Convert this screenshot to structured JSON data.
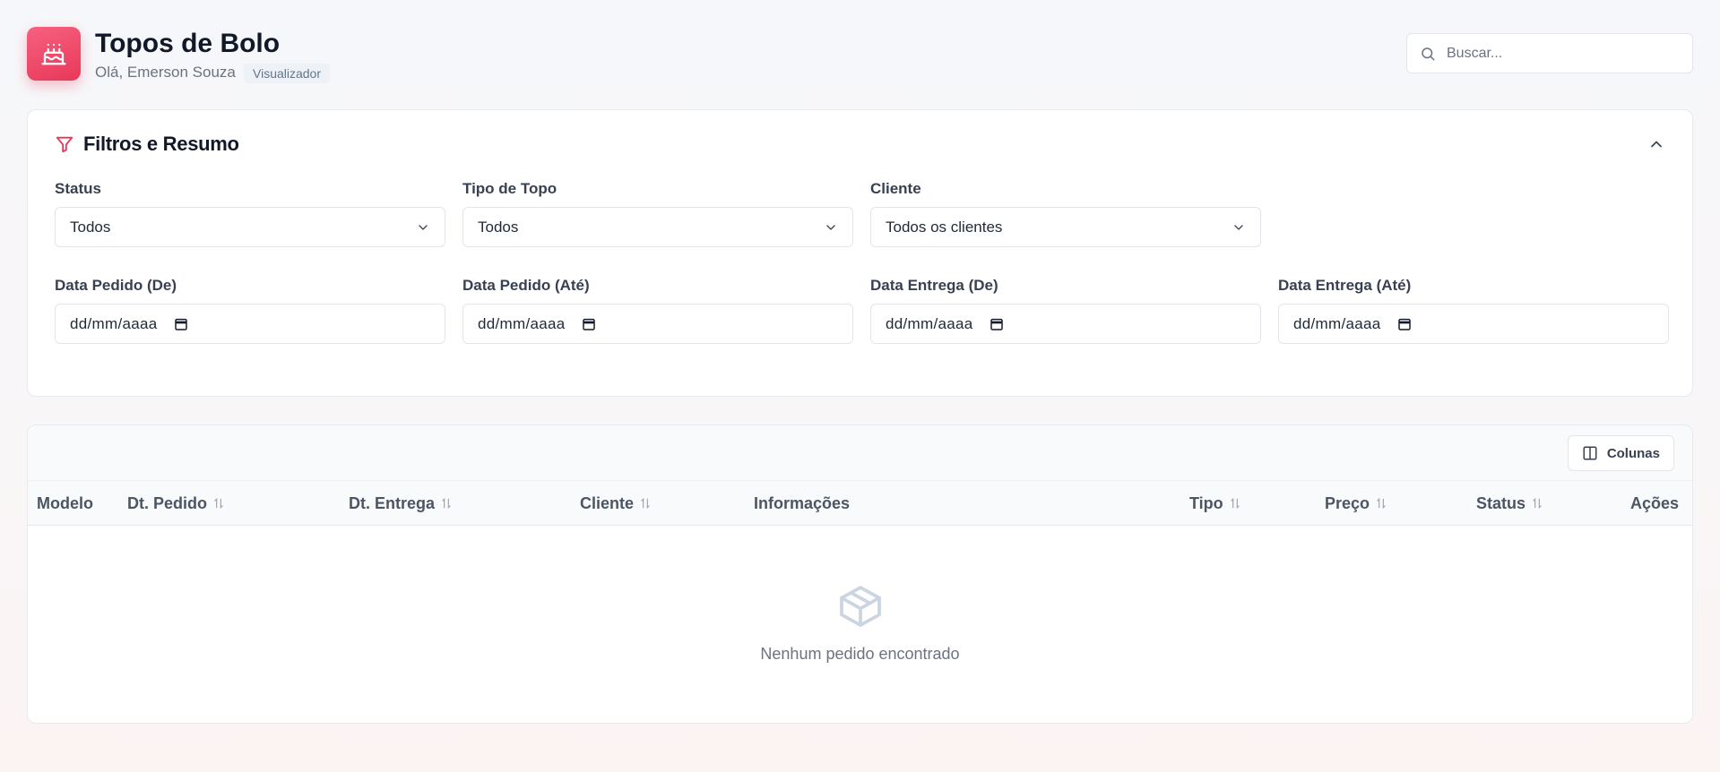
{
  "header": {
    "app_title": "Topos de Bolo",
    "greeting": "Olá, Emerson Souza",
    "role_badge": "Visualizador",
    "logo_icon": "cake-icon",
    "search_placeholder": "Buscar..."
  },
  "filters": {
    "title": "Filtros e Resumo",
    "status": {
      "label": "Status",
      "value": "Todos"
    },
    "tipo_topo": {
      "label": "Tipo de Topo",
      "value": "Todos"
    },
    "cliente": {
      "label": "Cliente",
      "value": "Todos os clientes"
    },
    "data_pedido_de": {
      "label": "Data Pedido (De)",
      "placeholder": "dd/mm/aaaa"
    },
    "data_pedido_ate": {
      "label": "Data Pedido (Até)",
      "placeholder": "dd/mm/aaaa"
    },
    "data_entrega_de": {
      "label": "Data Entrega (De)",
      "placeholder": "dd/mm/aaaa"
    },
    "data_entrega_ate": {
      "label": "Data Entrega (Até)",
      "placeholder": "dd/mm/aaaa"
    }
  },
  "table": {
    "columns_button": "Colunas",
    "headers": [
      "Modelo",
      "Dt. Pedido",
      "Dt. Entrega",
      "Cliente",
      "Informações",
      "Tipo",
      "Preço",
      "Status",
      "Ações"
    ],
    "empty_message": "Nenhum pedido encontrado"
  },
  "colors": {
    "accent": "#e8385a",
    "border": "#e2e5ea",
    "muted_text": "#6b7280"
  }
}
